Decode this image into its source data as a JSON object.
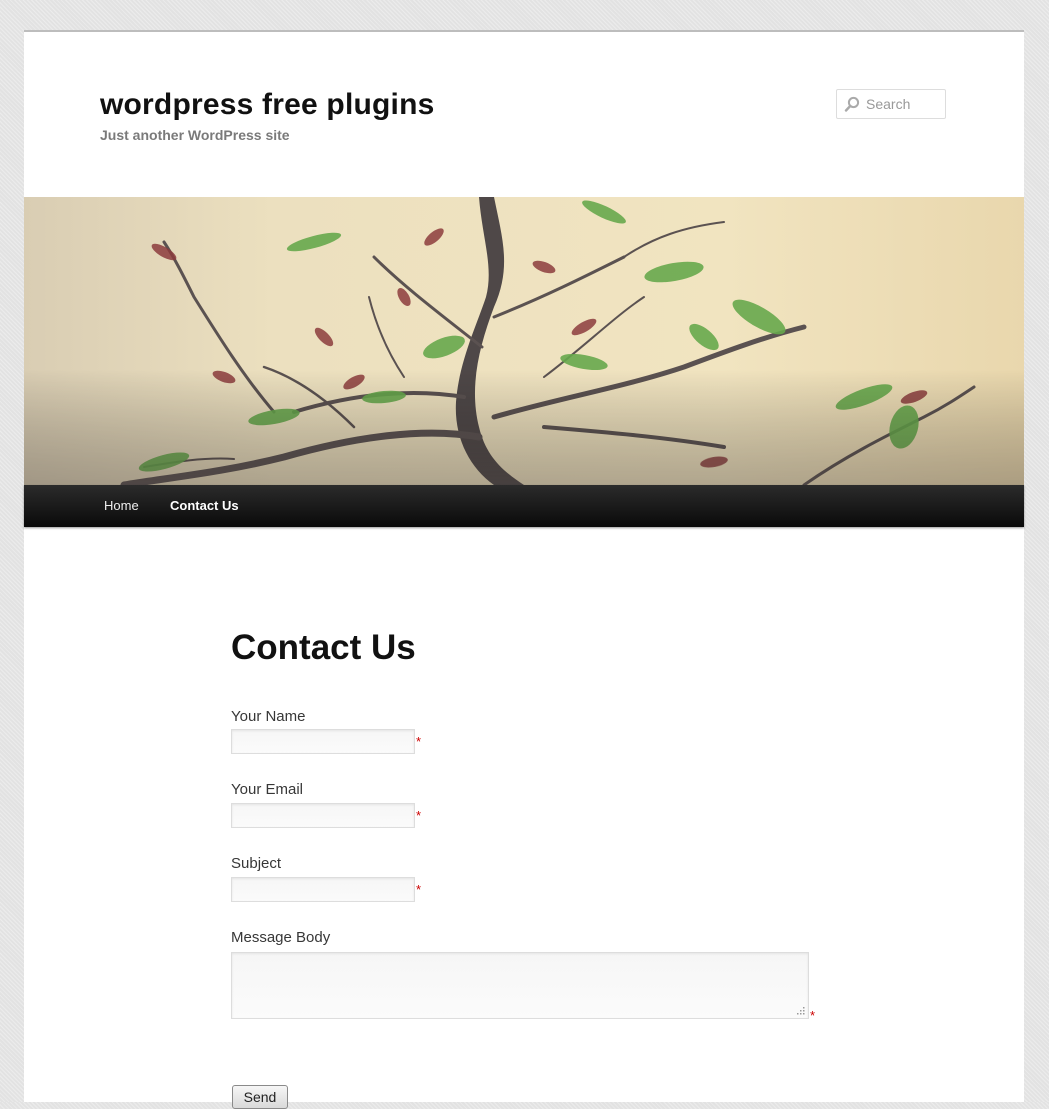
{
  "site": {
    "title": "wordpress free plugins",
    "description": "Just another WordPress site"
  },
  "search": {
    "placeholder": "Search",
    "icon": "magnifier-icon"
  },
  "header_image": {
    "subject": "bonsai-branches-photo",
    "colors": {
      "background": "#efe3bd",
      "branch": "#5a5150",
      "leaf_green": "#63a74a",
      "leaf_red": "#8e3a3a"
    }
  },
  "nav": {
    "items": [
      {
        "label": "Home",
        "active": false
      },
      {
        "label": "Contact Us",
        "active": true
      }
    ]
  },
  "page": {
    "title": "Contact Us"
  },
  "form": {
    "fields": [
      {
        "label": "Your Name",
        "value": "",
        "required": true,
        "required_mark": "*"
      },
      {
        "label": "Your Email",
        "value": "",
        "required": true,
        "required_mark": "*"
      },
      {
        "label": "Subject",
        "value": "",
        "required": true,
        "required_mark": "*"
      },
      {
        "label": "Message Body",
        "value": "",
        "required": true,
        "required_mark": "*",
        "multiline": true
      }
    ],
    "submit_label": "Send"
  },
  "colors": {
    "nav_background": "#111111",
    "required": "#cc0000",
    "page_background": "#e2e2e2"
  }
}
